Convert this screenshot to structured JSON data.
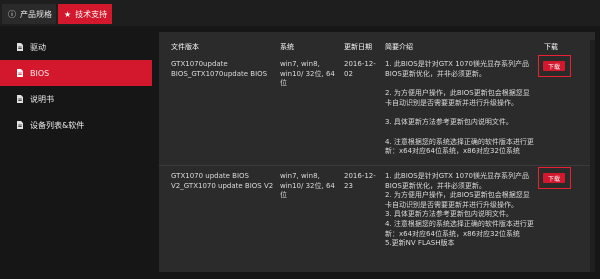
{
  "tabs": [
    {
      "label": "产品规格",
      "icon": "info-icon"
    },
    {
      "label": "技术支持",
      "icon": "star-icon"
    }
  ],
  "sidebar": {
    "items": [
      {
        "label": "驱动",
        "icon": "document-icon"
      },
      {
        "label": "BIOS",
        "icon": "document-icon"
      },
      {
        "label": "说明书",
        "icon": "document-icon"
      },
      {
        "label": "设备列表&软件",
        "icon": "document-icon"
      }
    ]
  },
  "table": {
    "headers": {
      "file": "文件版本",
      "system": "系统",
      "date": "更新日期",
      "desc": "简要介绍",
      "download": "下载"
    },
    "rows": [
      {
        "file": [
          "GTX1070update",
          "BIOS_GTX1070update BIOS"
        ],
        "system": [
          "win7, win8,",
          "win10/ 32位, 64",
          "位"
        ],
        "date": [
          "2016-12-",
          "02"
        ],
        "desc": [
          "1. 此BIOS是针对GTX 1070镁光显存系列产品",
          "BIOS更新优化，并非必须更新。",
          "",
          "2. 为方便用户操作，此BIOS更新包会根据您显",
          "卡自动识别是否需要更新并进行升级操作。",
          "",
          "3. 具体更新方法参考更新包内说明文件。",
          "",
          "4. 注意根据您的系统选择正确的软件版本进行更",
          "新：x64对应64位系统，x86对应32位系统"
        ],
        "download": "下载"
      },
      {
        "file": [
          "GTX1070 update BIOS",
          "V2_GTX1070 update BIOS V2"
        ],
        "system": [
          "win7, win8,",
          "win10/ 32位, 64",
          "位"
        ],
        "date": [
          "2016-12-",
          "23"
        ],
        "desc": [
          "1. 此BIOS是针对GTX 1070镁光显存系列产品",
          "BIOS更新优化，并非必须更新。",
          "2. 为方便用户操作，此BIOS更新包会根据您显",
          "卡自动识别是否需要更新并进行升级操作。",
          "3. 具体更新方法参考更新包内说明文件。",
          "4. 注意根据您的系统选择正确的软件版本进行更",
          "新：x64对应64位系统，x86对应32位系统",
          "5.更新NV FLASH版本"
        ],
        "download": "下载"
      }
    ]
  },
  "colors": {
    "accent": "#d3182d",
    "highlight_border": "#e8232f",
    "panel": "#2b2b2b",
    "background": "#161616"
  }
}
